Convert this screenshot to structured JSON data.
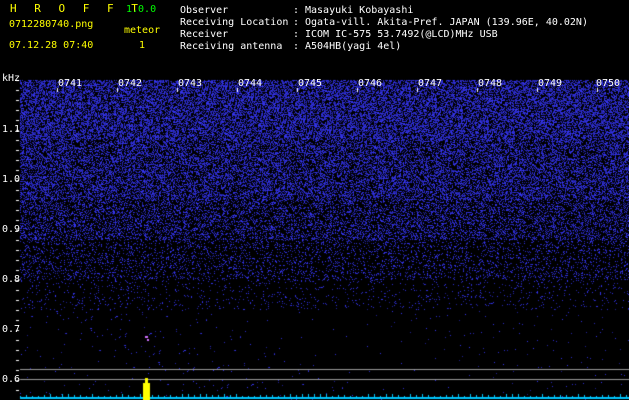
{
  "header": {
    "app_name": "H R O F F T",
    "version": "1.0.0",
    "filename": "0712280740.png",
    "datetime": "07.12.28 07:40",
    "meteor_label": "meteor",
    "meteor_count": "1",
    "rows": [
      {
        "label": "Observer",
        "colon": ":",
        "value": "Masayuki Kobayashi"
      },
      {
        "label": "Receiving Location",
        "colon": ":",
        "value": "Ogata-vill. Akita-Pref. JAPAN (139.96E, 40.02N)"
      },
      {
        "label": "Receiver",
        "colon": ":",
        "value": "ICOM IC-575 53.7492(@LCD)MHz USB"
      },
      {
        "label": "Receiving antenna",
        "colon": ":",
        "value": "A504HB(yagi 4el)"
      }
    ]
  },
  "axis": {
    "y_unit": "kHz",
    "y_ticks": [
      "1.1",
      "1.0",
      "0.9",
      "0.8",
      "0.7",
      "0.6"
    ],
    "x_ticks": [
      "0741",
      "0742",
      "0743",
      "0744",
      "0745",
      "0746",
      "0747",
      "0748",
      "0749",
      "0750"
    ]
  },
  "colors": {
    "background": "#000000",
    "noise": "#2a2aff",
    "text_header": "#ffff00",
    "version": "#00ff00",
    "meteor_echo": "#ffff00",
    "baseline": "#00c8ff"
  }
}
